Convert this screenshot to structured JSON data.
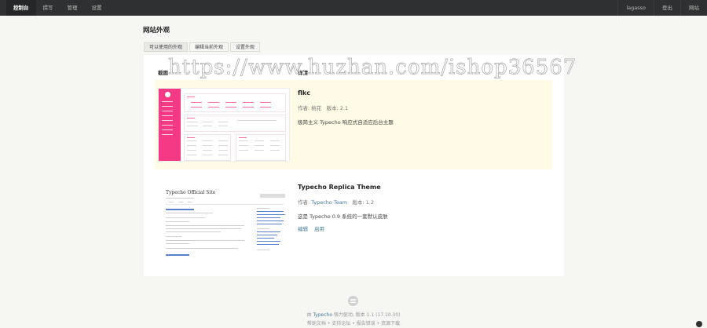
{
  "topnav": {
    "left": [
      "控制台",
      "撰写",
      "管理",
      "设置"
    ],
    "right": [
      "lagasso",
      "登出",
      "网站"
    ]
  },
  "page": {
    "title": "网站外观",
    "tabs": [
      "可以使用的外观",
      "编辑当前外观",
      "设置外观"
    ]
  },
  "table": {
    "headers": [
      "截图",
      "详情"
    ]
  },
  "themes": [
    {
      "name": "flkc",
      "author_label": "作者:",
      "author": "桃花",
      "version_label": "版本:",
      "version": "2.1",
      "description": "极简主义 Typecho 响应式自适应后台主题",
      "actions": []
    },
    {
      "name": "Typecho Replica Theme",
      "author_label": "作者:",
      "author": "Typecho Team",
      "version_label": "版本:",
      "version": "1.2",
      "description": "这是 Typecho 0.9 系统的一套默认皮肤",
      "actions": [
        "编辑",
        "启用"
      ],
      "preview": {
        "site_title": "Typecho Official Site"
      }
    }
  ],
  "footer": {
    "prefix": "由",
    "brand": "Typecho",
    "suffix": "强力驱动, 版本 1.1 (17.10.30)",
    "links": [
      "帮助文档",
      "支持论坛",
      "报告错误",
      "资源下载"
    ]
  },
  "watermark": "https://www.huzhan.com/ishop36567",
  "colors": {
    "topbar": "#2f3031",
    "accent_link": "#467b96",
    "current_row": "#fffbe6",
    "flkc_pink": "#f53a85"
  }
}
